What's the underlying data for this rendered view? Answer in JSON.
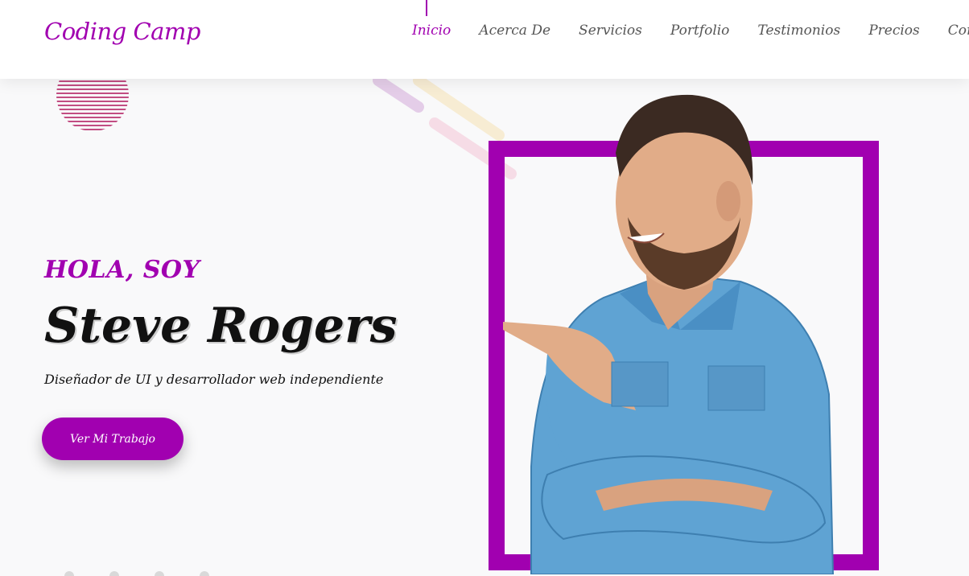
{
  "brand": {
    "logo": "Coding Camp"
  },
  "nav": {
    "items": [
      {
        "label": "Inicio",
        "active": true
      },
      {
        "label": "Acerca De"
      },
      {
        "label": "Servicios"
      },
      {
        "label": "Portfolio"
      },
      {
        "label": "Testimonios"
      },
      {
        "label": "Precios"
      },
      {
        "label": "Contacto"
      }
    ]
  },
  "hero": {
    "greeting": "HOLA, SOY",
    "name": "Steve Rogers",
    "subtitle": "Diseñador de UI y desarrollador web independiente",
    "cta_label": "Ver Mi Trabajo"
  },
  "colors": {
    "accent": "#a100b0",
    "background": "#f9f9fa",
    "text": "#111111",
    "nav_text": "#555555"
  }
}
